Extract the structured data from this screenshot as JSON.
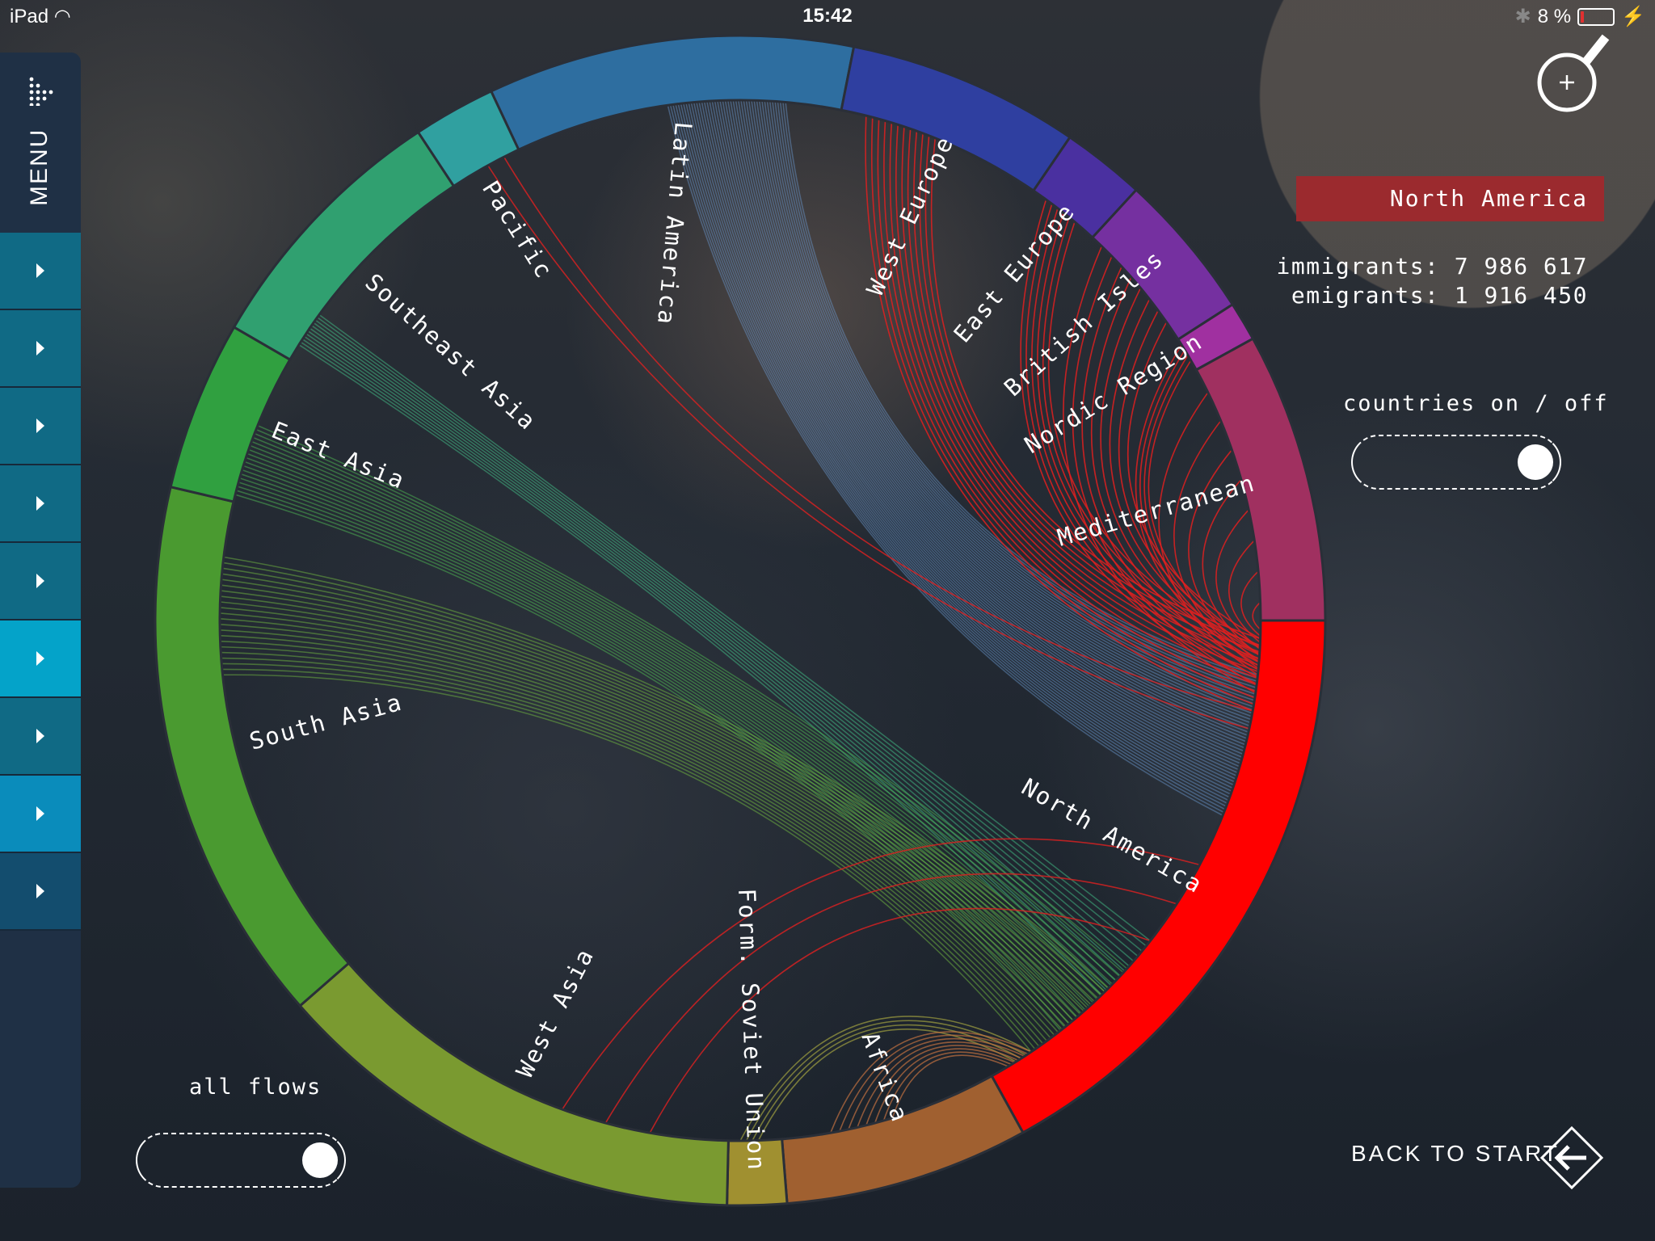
{
  "status_bar": {
    "device": "iPad",
    "time": "15:42",
    "battery": "8 %",
    "battery_level": 0.08
  },
  "sidebar": {
    "menu_label": "MENU",
    "items": 9,
    "active_index": 5
  },
  "info": {
    "region": "North America",
    "immigrants": "immigrants: 7 986 617",
    "emigrants": "emigrants: 1 916 450",
    "color": "#9b2a2e"
  },
  "toggles": {
    "countries": {
      "label": "countries on / off",
      "state": "on"
    },
    "flows": {
      "label": "all flows",
      "state": "on"
    }
  },
  "back": {
    "label": "BACK TO START"
  },
  "chart_data": {
    "type": "chord",
    "selected": "North America",
    "segments": [
      {
        "name": "Latin America",
        "color": "#2e6ea0",
        "start_deg": -25.2,
        "end_deg": 11.2
      },
      {
        "name": "West Europe",
        "color": "#2f3fa0",
        "start_deg": 11.2,
        "end_deg": 34.3
      },
      {
        "name": "East Europe",
        "color": "#4a30a0",
        "start_deg": 34.3,
        "end_deg": 42.6
      },
      {
        "name": "British Isles",
        "color": "#7530a0",
        "start_deg": 42.6,
        "end_deg": 57.3
      },
      {
        "name": "Nordic Region",
        "color": "#a030a0",
        "start_deg": 57.3,
        "end_deg": 61.2
      },
      {
        "name": "Mediterranean",
        "color": "#a03060",
        "start_deg": 61.2,
        "end_deg": 90
      },
      {
        "name": "North America",
        "color": "#ff0000",
        "start_deg": 90,
        "end_deg": 151.1
      },
      {
        "name": "Africa",
        "color": "#a06030",
        "start_deg": 151.1,
        "end_deg": 175.4
      },
      {
        "name": "Form. Soviet Union",
        "color": "#a09030",
        "start_deg": 175.4,
        "end_deg": 181.3
      },
      {
        "name": "West Asia",
        "color": "#7a9a30",
        "start_deg": 181.3,
        "end_deg": 228.8
      },
      {
        "name": "South Asia",
        "color": "#4a9a30",
        "start_deg": 228.8,
        "end_deg": 283.2
      },
      {
        "name": "East Asia",
        "color": "#30a040",
        "start_deg": 283.2,
        "end_deg": 300.1
      },
      {
        "name": "Southeast Asia",
        "color": "#30a070",
        "start_deg": 300.1,
        "end_deg": 326.6
      },
      {
        "name": "Pacific",
        "color": "#30a0a0",
        "start_deg": 326.6,
        "end_deg": 334.8
      }
    ],
    "flows_to": "North America",
    "flow_colors": {
      "emigration": "#e02020"
    }
  }
}
